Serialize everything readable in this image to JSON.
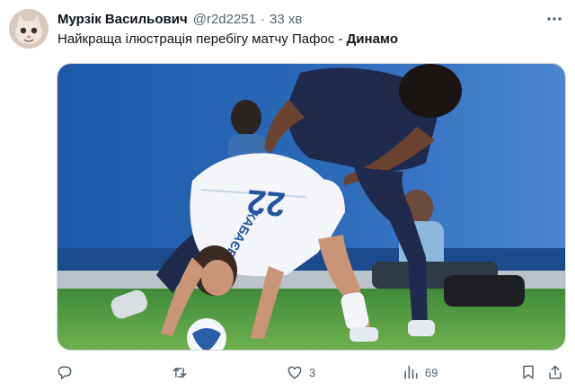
{
  "tweet": {
    "author_name": "Мурзік Васильович",
    "handle": "@r2d2251",
    "separator": "·",
    "time": "33 хв",
    "text_plain": "Найкраща ілюстрація перебігу матчу Пафос - ",
    "text_bold": "Динамо"
  },
  "media": {
    "jersey_number": "22",
    "jersey_name": "КАБАЄВ"
  },
  "actions": {
    "reply_count": "",
    "repost_count": "",
    "like_count": "3",
    "views_count": "69"
  },
  "icons": {
    "avatar": "cat-avatar",
    "more": "more-icon",
    "reply": "reply-icon",
    "repost": "repost-icon",
    "like": "like-icon",
    "views": "views-icon",
    "bookmark": "bookmark-icon",
    "share": "share-icon"
  }
}
